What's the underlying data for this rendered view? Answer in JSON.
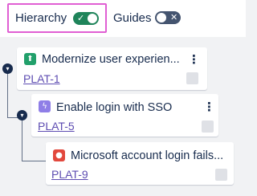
{
  "toolbar": {
    "hierarchy_label": "Hierarchy",
    "hierarchy_enabled": true,
    "guides_label": "Guides",
    "guides_enabled": false
  },
  "colors": {
    "highlight_border": "#e05fd3",
    "toggle_on": "#1f845a",
    "toggle_off": "#44546f",
    "link": "#5e4db2",
    "story_icon": "#22a06b",
    "epic_icon": "#8f7ee7",
    "bug_icon": "#e2483d"
  },
  "issues": [
    {
      "type_icon": "story-arrow-up-icon",
      "summary": "Modernize user experien...",
      "key": "PLAT-1"
    },
    {
      "type_icon": "epic-lightning-icon",
      "summary": "Enable login with SSO",
      "key": "PLAT-5"
    },
    {
      "type_icon": "bug-dot-icon",
      "summary": "Microsoft account login fails...",
      "key": "PLAT-9"
    }
  ]
}
